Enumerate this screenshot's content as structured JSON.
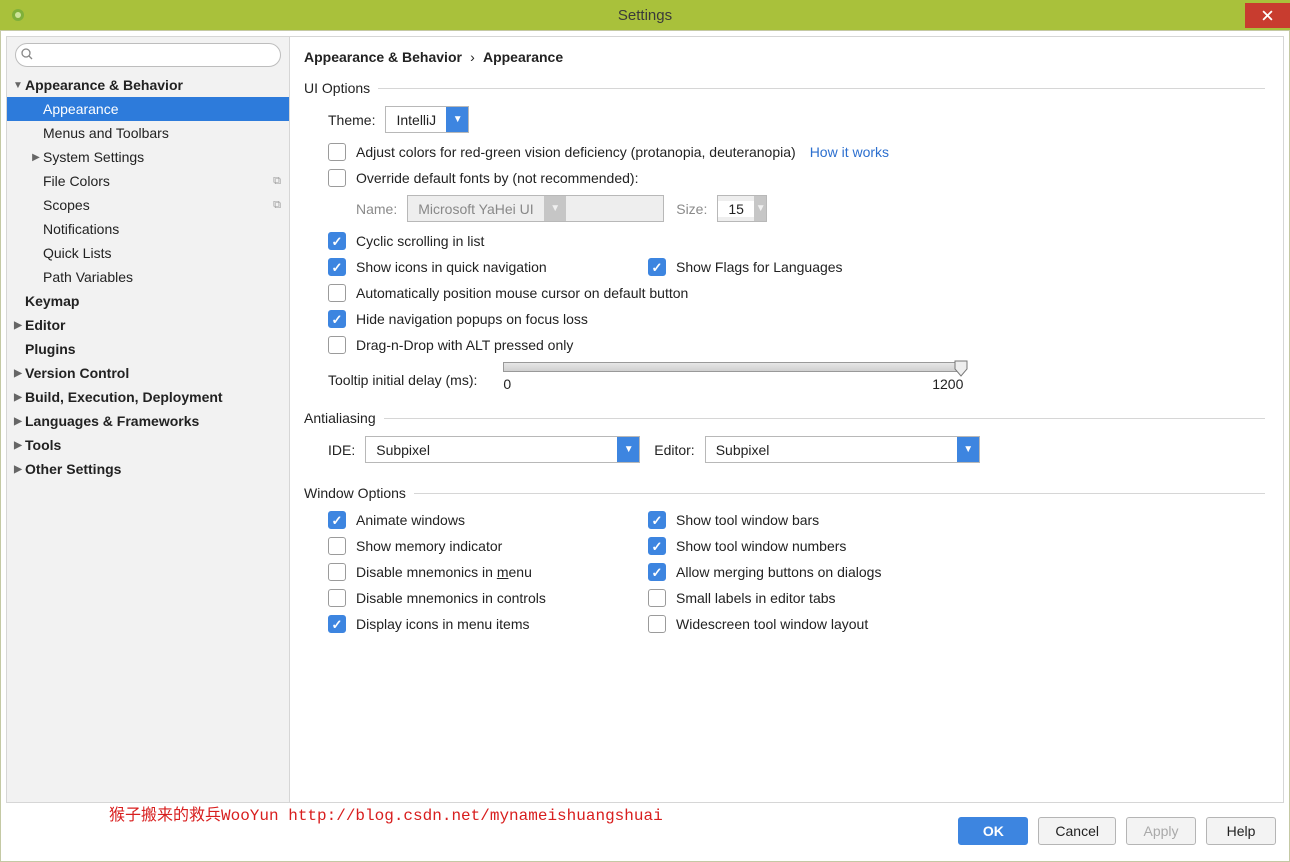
{
  "window": {
    "title": "Settings"
  },
  "breadcrumb": {
    "parent": "Appearance & Behavior",
    "current": "Appearance"
  },
  "sidebar": {
    "search_placeholder": "",
    "items": [
      {
        "label": "Appearance & Behavior",
        "bold": true,
        "level": 0,
        "twisty": "▼"
      },
      {
        "label": "Appearance",
        "bold": false,
        "level": 1,
        "selected": true
      },
      {
        "label": "Menus and Toolbars",
        "bold": false,
        "level": 1
      },
      {
        "label": "System Settings",
        "bold": false,
        "level": 1,
        "twisty": "▶"
      },
      {
        "label": "File Colors",
        "bold": false,
        "level": 1,
        "copy": true
      },
      {
        "label": "Scopes",
        "bold": false,
        "level": 1,
        "copy": true
      },
      {
        "label": "Notifications",
        "bold": false,
        "level": 1
      },
      {
        "label": "Quick Lists",
        "bold": false,
        "level": 1
      },
      {
        "label": "Path Variables",
        "bold": false,
        "level": 1
      },
      {
        "label": "Keymap",
        "bold": true,
        "level": 0
      },
      {
        "label": "Editor",
        "bold": true,
        "level": 0,
        "twisty": "▶"
      },
      {
        "label": "Plugins",
        "bold": true,
        "level": 0
      },
      {
        "label": "Version Control",
        "bold": true,
        "level": 0,
        "twisty": "▶"
      },
      {
        "label": "Build, Execution, Deployment",
        "bold": true,
        "level": 0,
        "twisty": "▶"
      },
      {
        "label": "Languages & Frameworks",
        "bold": true,
        "level": 0,
        "twisty": "▶"
      },
      {
        "label": "Tools",
        "bold": true,
        "level": 0,
        "twisty": "▶"
      },
      {
        "label": "Other Settings",
        "bold": true,
        "level": 0,
        "twisty": "▶"
      }
    ]
  },
  "ui_options": {
    "section": "UI Options",
    "theme_label": "Theme:",
    "theme_value": "IntelliJ",
    "adjust_colors": {
      "checked": false,
      "label": "Adjust colors for red-green vision deficiency (protanopia, deuteranopia)",
      "link": "How it works"
    },
    "override_fonts": {
      "checked": false,
      "label": "Override default fonts by (not recommended):"
    },
    "font_name_label": "Name:",
    "font_name_value": "Microsoft YaHei UI",
    "font_size_label": "Size:",
    "font_size_value": "15",
    "cyclic": {
      "checked": true,
      "label": "Cyclic scrolling in list"
    },
    "icons_qn": {
      "checked": true,
      "label": "Show icons in quick navigation"
    },
    "flags": {
      "checked": true,
      "label": "Show Flags for Languages"
    },
    "auto_mouse": {
      "checked": false,
      "label": "Automatically position mouse cursor on default button"
    },
    "hide_nav": {
      "checked": true,
      "label": "Hide navigation popups on focus loss"
    },
    "dnd_alt": {
      "checked": false,
      "label": "Drag-n-Drop with ALT pressed only"
    },
    "tooltip_label": "Tooltip initial delay (ms):",
    "tooltip_min": "0",
    "tooltip_max": "1200"
  },
  "antialiasing": {
    "section": "Antialiasing",
    "ide_label": "IDE:",
    "ide_value": "Subpixel",
    "editor_label": "Editor:",
    "editor_value": "Subpixel"
  },
  "window_options": {
    "section": "Window Options",
    "animate": {
      "checked": true,
      "label": "Animate windows"
    },
    "toolbars": {
      "checked": true,
      "label": "Show tool window bars"
    },
    "memory": {
      "checked": false,
      "label": "Show memory indicator"
    },
    "numbers": {
      "checked": true,
      "label": "Show tool window numbers"
    },
    "mn_menu": {
      "checked": false,
      "label_pre": "Disable mnemonics in ",
      "label_u": "m",
      "label_post": "enu"
    },
    "merge": {
      "checked": true,
      "label": "Allow merging buttons on dialogs"
    },
    "mn_ctrl": {
      "checked": false,
      "label": "Disable mnemonics in controls"
    },
    "small_lbl": {
      "checked": false,
      "label": "Small labels in editor tabs"
    },
    "icons_menu": {
      "checked": true,
      "label": "Display icons in menu items"
    },
    "widescreen": {
      "checked": false,
      "label": "Widescreen tool window layout"
    }
  },
  "footer": {
    "ok": "OK",
    "cancel": "Cancel",
    "apply": "Apply",
    "help": "Help"
  },
  "watermark": "猴子搬来的救兵WooYun http://blog.csdn.net/mynameishuangshuai"
}
